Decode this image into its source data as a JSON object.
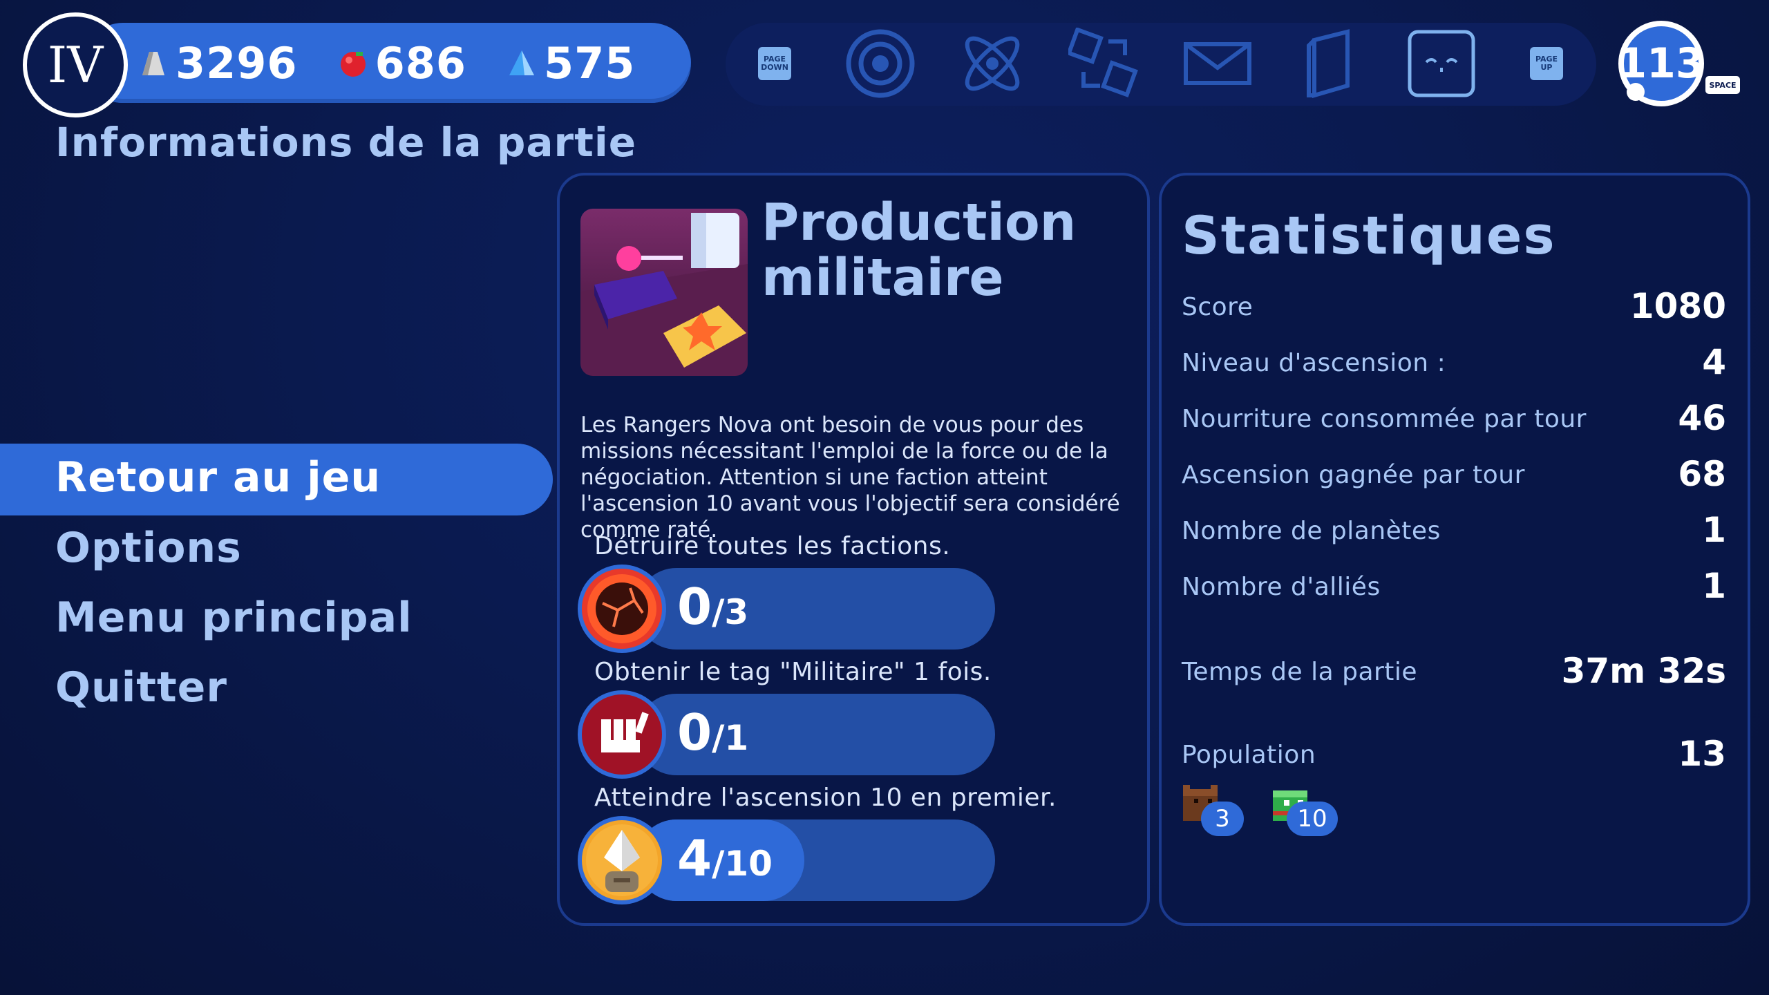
{
  "hud": {
    "era": "IV",
    "resources": [
      {
        "name": "production",
        "icon": "production-icon",
        "value": "3296"
      },
      {
        "name": "food",
        "icon": "food-icon",
        "value": "686"
      },
      {
        "name": "science",
        "icon": "science-icon",
        "value": "575"
      }
    ],
    "toolbar": [
      {
        "icon": "page-down-key",
        "key": "PAGE DOWN"
      },
      {
        "icon": "galaxy-icon"
      },
      {
        "icon": "atom-icon"
      },
      {
        "icon": "trade-cubes-icon"
      },
      {
        "icon": "mail-icon"
      },
      {
        "icon": "codex-book-icon"
      },
      {
        "icon": "face-icon"
      },
      {
        "icon": "page-up-key",
        "key": "PAGE UP"
      }
    ],
    "turn": "113",
    "turn_key": "SPACE"
  },
  "page_title": "Informations de la partie",
  "menu": {
    "items": [
      "Retour au jeu",
      "Options",
      "Menu principal",
      "Quitter"
    ],
    "active_index": 0
  },
  "objective": {
    "title_line1": "Production",
    "title_line2": "militaire",
    "description": "Les Rangers Nova ont besoin de vous pour des missions nécessitant l'emploi de la force ou de la négociation. Attention si une faction atteint l'ascension 10 avant vous l'objectif sera considéré comme raté.",
    "goals": [
      {
        "label": "Détruire toutes les factions.",
        "current": "0",
        "total": "/3",
        "progress": 0,
        "icon": "destroy-planet-icon"
      },
      {
        "label": "Obtenir le tag \"Militaire\" 1 fois.",
        "current": "0",
        "total": "/1",
        "progress": 0,
        "icon": "military-fist-icon"
      },
      {
        "label": "Atteindre l'ascension 10 en premier.",
        "current": "4",
        "total": "/10",
        "progress": 0.4,
        "icon": "ascension-crystal-icon"
      }
    ]
  },
  "stats": {
    "title": "Statistiques",
    "rows": [
      {
        "label": "Score",
        "value": "1080"
      },
      {
        "label": "Niveau d'ascension :",
        "value": "4"
      },
      {
        "label": "Nourriture consommée par tour",
        "value": "46"
      },
      {
        "label": "Ascension gagnée par tour",
        "value": "68"
      },
      {
        "label": "Nombre de planètes",
        "value": "1"
      },
      {
        "label": "Nombre d'alliés",
        "value": "1"
      }
    ],
    "time_label": "Temps de la partie",
    "time_value": "37m 32s",
    "population_label": "Population",
    "population_value": "13",
    "species": [
      {
        "icon": "brown-species-icon",
        "count": "3"
      },
      {
        "icon": "green-species-icon",
        "count": "10"
      }
    ]
  }
}
